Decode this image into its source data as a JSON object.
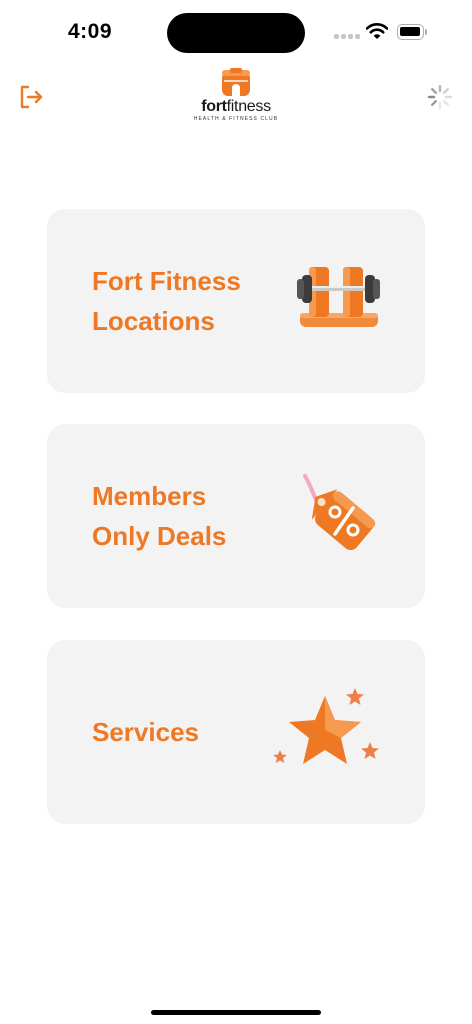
{
  "status_bar": {
    "time": "4:09",
    "icons": [
      "signal-icon",
      "wifi-icon",
      "battery-icon"
    ]
  },
  "header": {
    "left_icon": "logout-icon",
    "right_icon": "loading-spinner-icon",
    "logo": {
      "word_bold": "fort",
      "word_regular": "fitness",
      "tagline": "HEALTH & FITNESS CLUB"
    }
  },
  "menu": {
    "items": [
      {
        "label": "Fort Fitness\nLocations",
        "icon": "dumbbell-icon"
      },
      {
        "label": "Members\nOnly Deals",
        "icon": "discount-tag-icon"
      },
      {
        "label": "Services",
        "icon": "stars-icon"
      }
    ]
  },
  "colors": {
    "accent": "#ee7824",
    "card_background": "#f3f3f3",
    "background": "#ffffff"
  }
}
